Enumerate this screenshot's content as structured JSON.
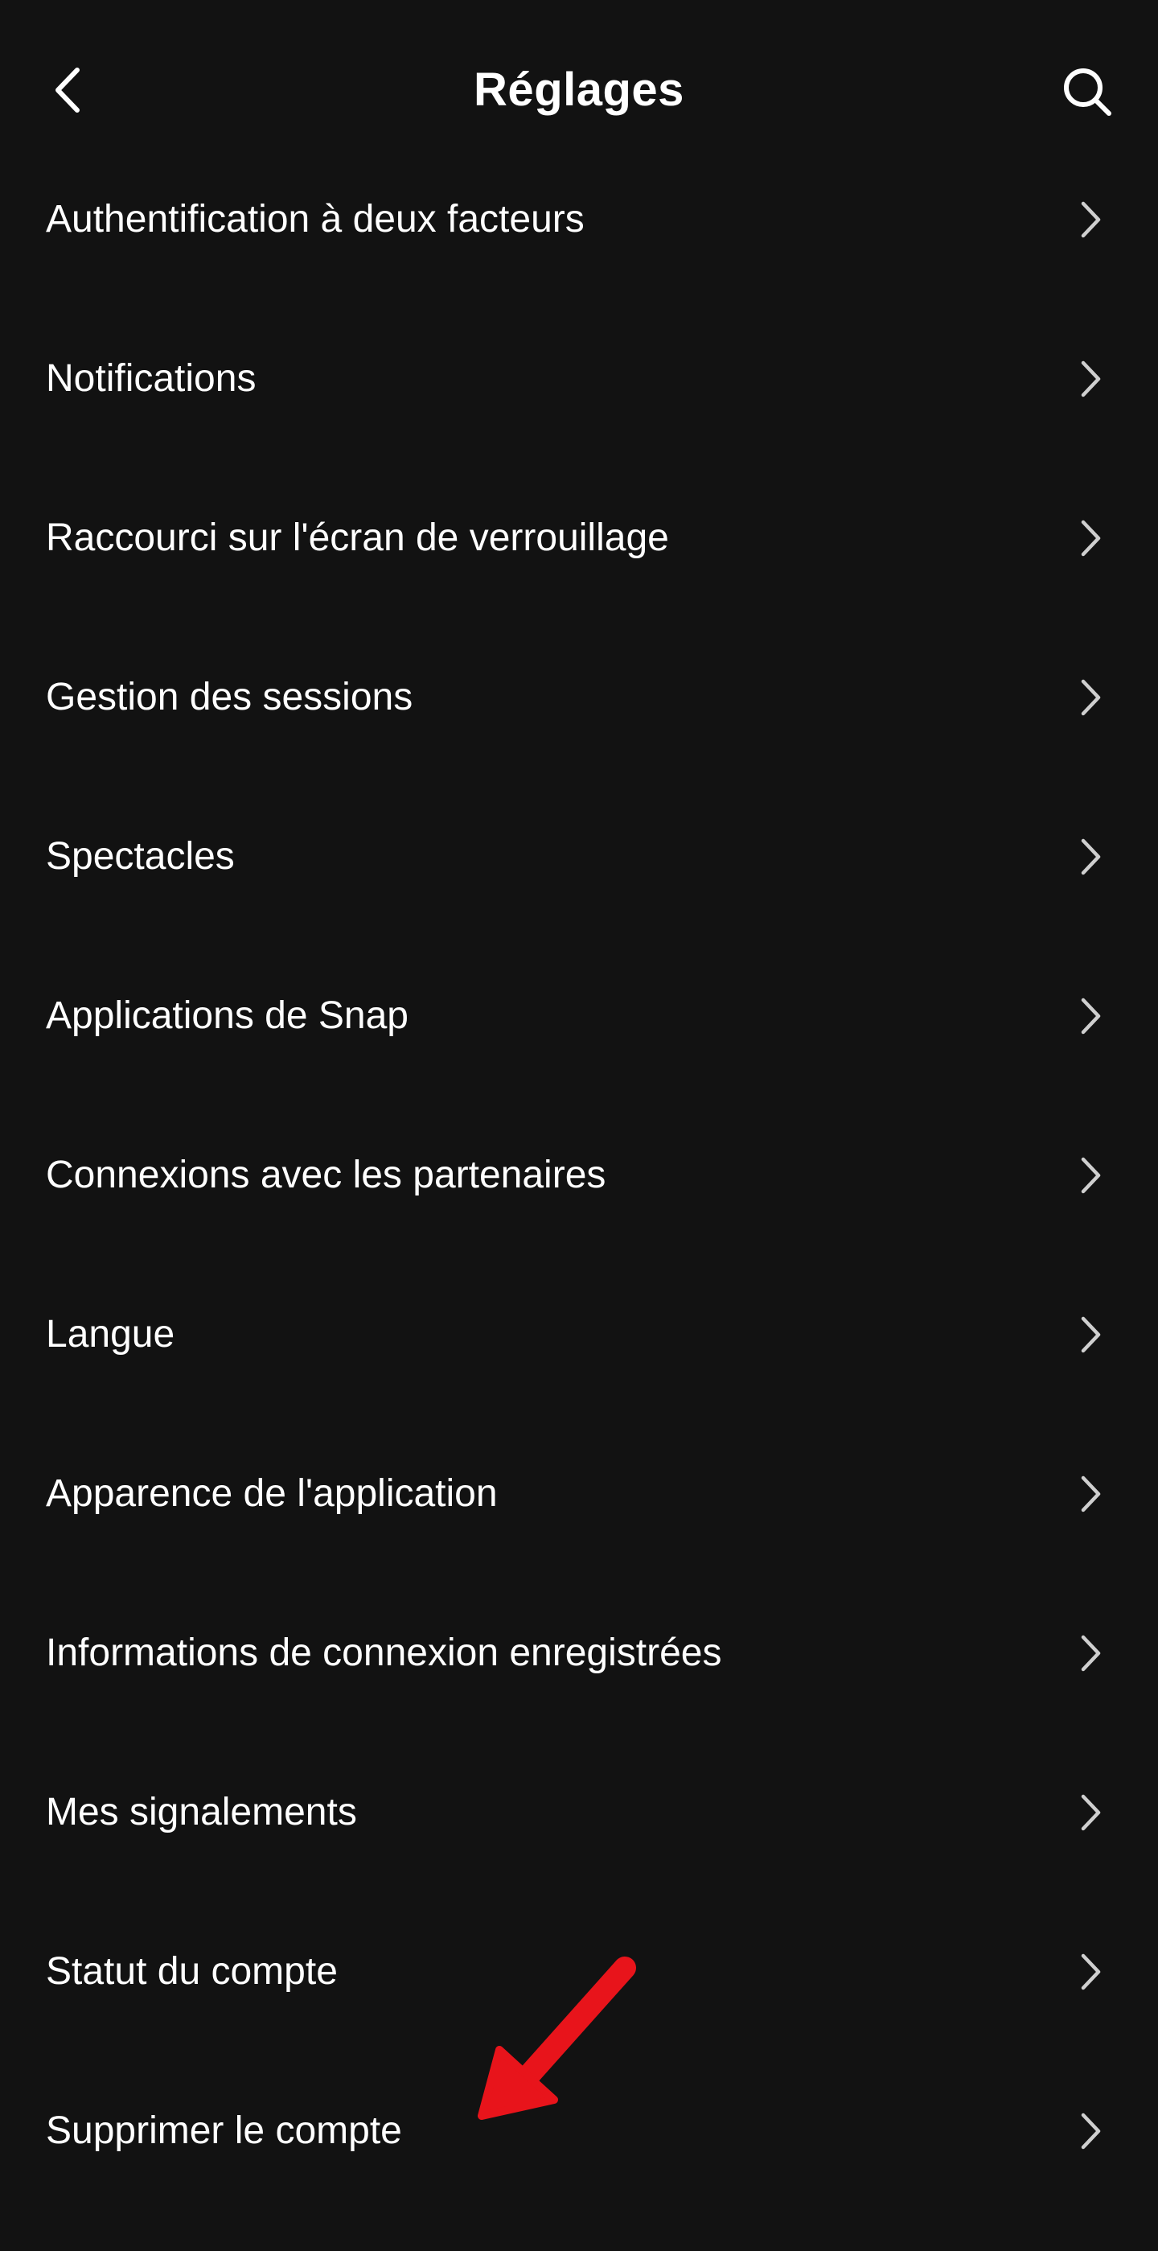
{
  "header": {
    "title": "Réglages",
    "back_icon": "chevron-left-icon",
    "search_icon": "search-icon"
  },
  "settings": {
    "items": [
      {
        "label": "Authentification à deux facteurs"
      },
      {
        "label": "Notifications"
      },
      {
        "label": "Raccourci sur l'écran de verrouillage"
      },
      {
        "label": "Gestion des sessions"
      },
      {
        "label": "Spectacles"
      },
      {
        "label": "Applications de Snap"
      },
      {
        "label": "Connexions avec les partenaires"
      },
      {
        "label": "Langue"
      },
      {
        "label": "Apparence de l'application"
      },
      {
        "label": "Informations de connexion enregistrées"
      },
      {
        "label": "Mes signalements"
      },
      {
        "label": "Statut du compte"
      },
      {
        "label": "Supprimer le compte"
      }
    ],
    "chevron_icon": "chevron-right-icon"
  },
  "annotation": {
    "icon": "red-arrow-icon",
    "color": "#e8141b"
  },
  "colors": {
    "background": "#121212",
    "text": "#ffffff",
    "chevron": "#cfcfcf"
  }
}
